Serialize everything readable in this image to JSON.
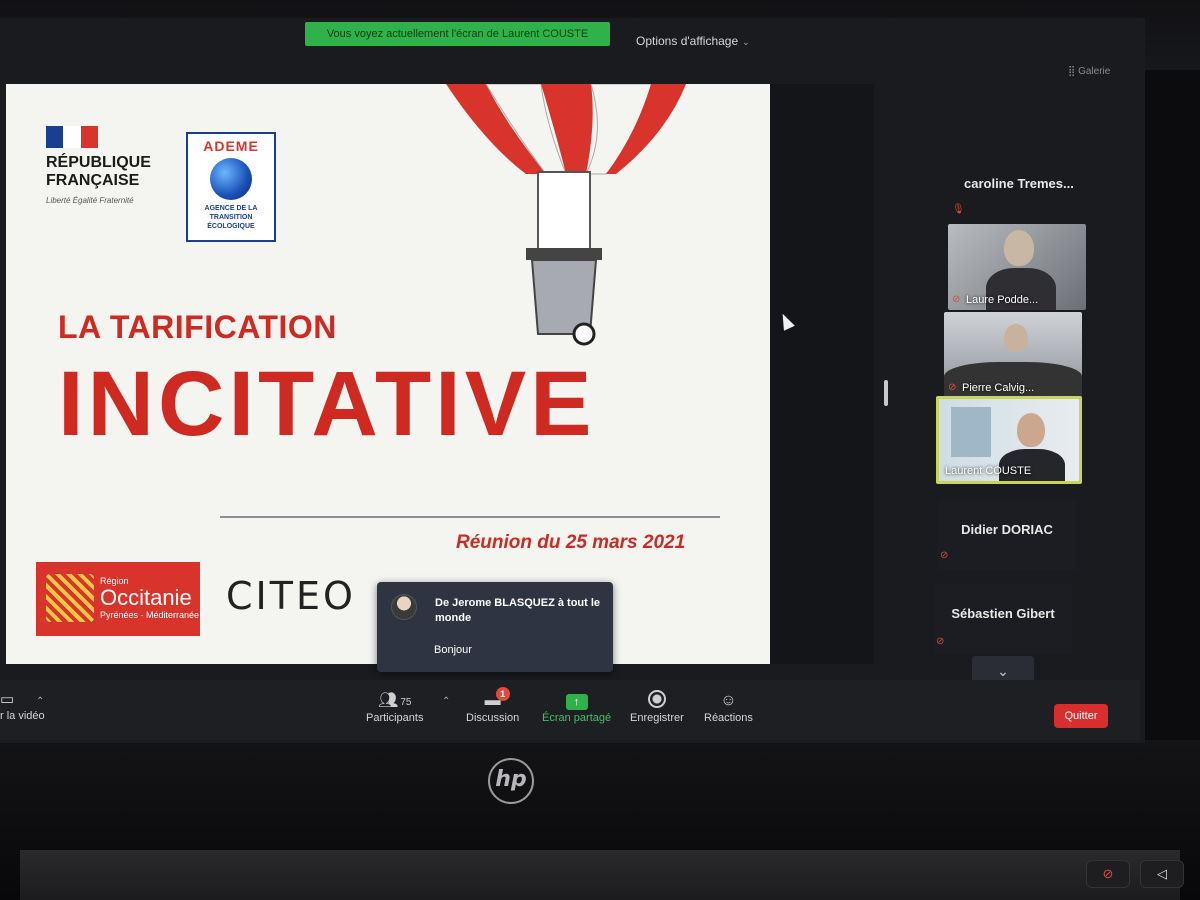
{
  "banner": {
    "share_text": "Vous voyez actuellement l'écran de Laurent COUSTE",
    "view_options": "Options d'affichage",
    "gallery_toggle": "⣿ Galerie"
  },
  "slide": {
    "rf_name_line1": "RÉPUBLIQUE",
    "rf_name_line2": "FRANÇAISE",
    "rf_motto": "Liberté Égalité Fraternité",
    "ademe_title": "ADEME",
    "ademe_sub": "AGENCE DE LA TRANSITION ÉCOLOGIQUE",
    "title_small": "LA TARIFICATION",
    "title_big": "INCITATIVE",
    "date": "Réunion du 25 mars 2021",
    "occitanie_region": "Région",
    "occitanie_name": "Occitanie",
    "occitanie_sub": "Pyrénées · Méditerranée",
    "citeo": "CITEO"
  },
  "chat": {
    "from": "De Jerome BLASQUEZ à tout le monde",
    "message": "Bonjour"
  },
  "participants": {
    "top_name": "caroline Tremes...",
    "tiles": [
      {
        "name": "Laure Podde..."
      },
      {
        "name": "Pierre Calvig..."
      },
      {
        "name": "Laurent COUSTE"
      }
    ],
    "name_tiles": [
      {
        "name": "Didier DORIAC"
      },
      {
        "name": "Sébastien Gibert"
      }
    ]
  },
  "toolbar": {
    "video_label": "r la vidéo",
    "participants_label": "Participants",
    "participants_count": "75",
    "chat_label": "Discussion",
    "chat_badge": "1",
    "share_label": "Écran partagé",
    "record_label": "Enregistrer",
    "reactions_label": "Réactions",
    "quit_label": "Quitter"
  },
  "hardware": {
    "brand": "hp"
  },
  "colors": {
    "accent_red": "#cf2a22",
    "share_green": "#2fb24a",
    "quit_red": "#d92e2e"
  }
}
